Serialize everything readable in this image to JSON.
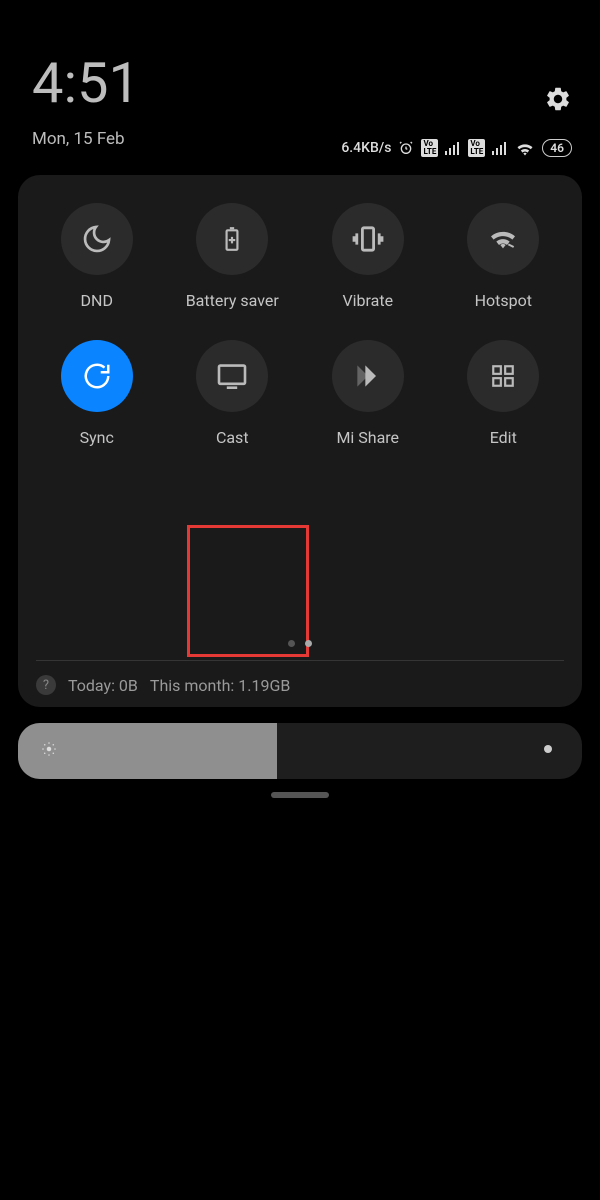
{
  "status": {
    "time": "4:51",
    "date": "Mon, 15 Feb",
    "net_speed": "6.4KB/s",
    "lte1": "Vo\nLTE",
    "lte2": "Vo\nLTE",
    "battery": "46"
  },
  "tiles": [
    {
      "label": "DND",
      "icon": "moon",
      "active": false
    },
    {
      "label": "Battery saver",
      "icon": "battery",
      "active": false
    },
    {
      "label": "Vibrate",
      "icon": "vibrate",
      "active": false
    },
    {
      "label": "Hotspot",
      "icon": "hotspot",
      "active": false
    },
    {
      "label": "Sync",
      "icon": "sync",
      "active": true
    },
    {
      "label": "Cast",
      "icon": "cast",
      "active": false,
      "highlighted": true
    },
    {
      "label": "Mi Share",
      "icon": "mishare",
      "active": false
    },
    {
      "label": "Edit",
      "icon": "edit",
      "active": false
    }
  ],
  "usage": {
    "today": "Today: 0B",
    "month": "This month: 1.19GB"
  },
  "brightness_pct": 46
}
